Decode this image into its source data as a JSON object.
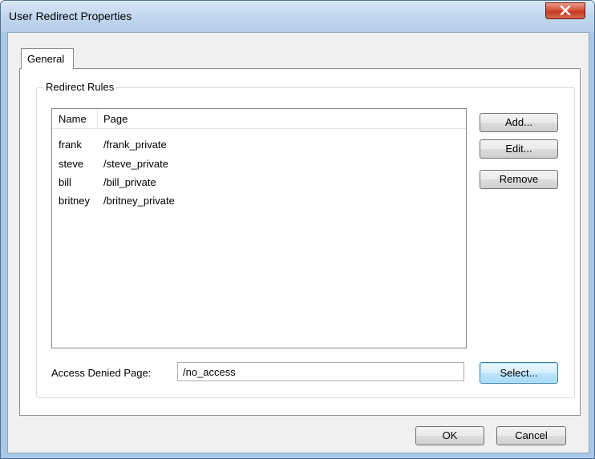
{
  "window": {
    "title": "User Redirect Properties"
  },
  "tabs": [
    {
      "label": "General"
    }
  ],
  "group": {
    "title": "Redirect Rules",
    "columns": [
      "Name",
      "Page"
    ],
    "rows": [
      {
        "name": "frank",
        "page": "/frank_private"
      },
      {
        "name": "steve",
        "page": "/steve_private"
      },
      {
        "name": "bill",
        "page": "/bill_private"
      },
      {
        "name": "britney",
        "page": "/britney_private"
      }
    ],
    "buttons": {
      "add": "Add...",
      "edit": "Edit...",
      "remove": "Remove",
      "select": "Select..."
    },
    "access_denied": {
      "label": "Access Denied Page:",
      "value": "/no_access"
    }
  },
  "footer": {
    "ok": "OK",
    "cancel": "Cancel"
  },
  "icons": {
    "close": "close-icon"
  },
  "colors": {
    "titlebar": "#c4d8ef",
    "close_button": "#c23a20",
    "panel": "#f0f0f0",
    "default_button": "#3c7fb1"
  }
}
